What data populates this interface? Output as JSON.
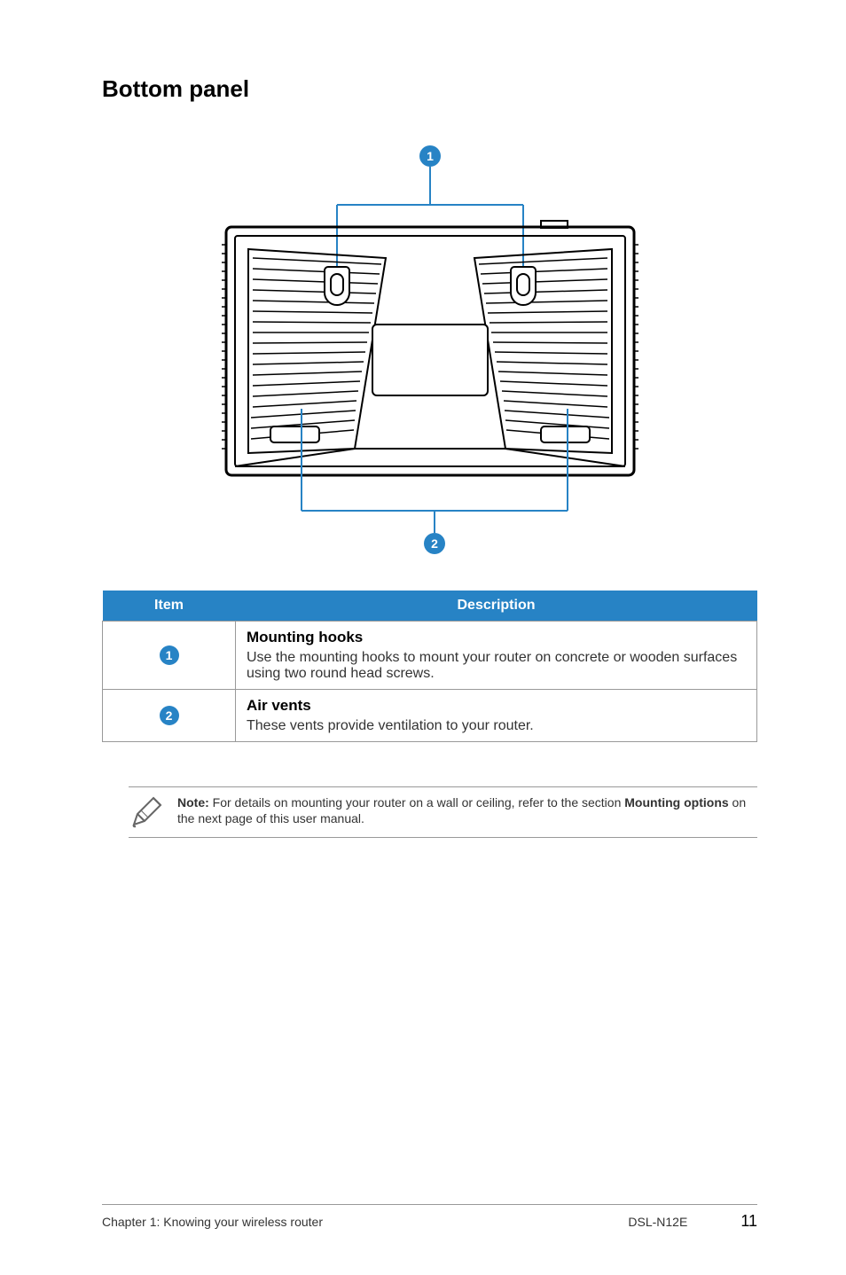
{
  "heading": "Bottom panel",
  "diagram": {
    "callout1": "1",
    "callout2": "2"
  },
  "table": {
    "headers": {
      "item": "Item",
      "description": "Description"
    },
    "rows": [
      {
        "badge": "1",
        "title": "Mounting hooks",
        "body": "Use the mounting hooks to mount your router on concrete or wooden surfaces using two round head screws."
      },
      {
        "badge": "2",
        "title": "Air vents",
        "body": "These vents provide ventilation to your router."
      }
    ]
  },
  "note": {
    "prefix": "Note:",
    "body_1": " For details on mounting your router on a wall or ceiling, refer to the section ",
    "bold_section": "Mounting options",
    "body_2": " on the next page of this user manual."
  },
  "footer": {
    "left": "Chapter 1: Knowing your wireless router",
    "model": "DSL-N12E",
    "page": "11"
  }
}
